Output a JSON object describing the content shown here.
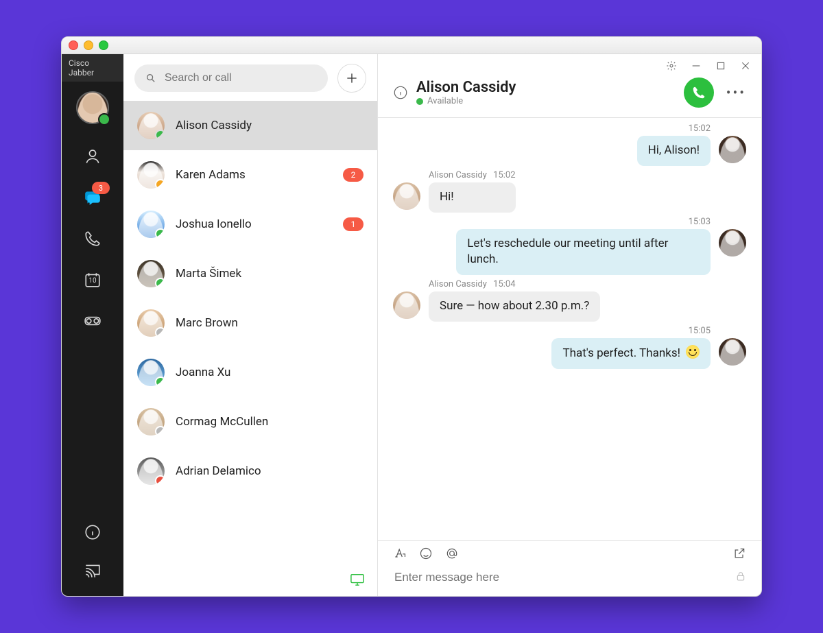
{
  "app_title": "Cisco Jabber",
  "search_placeholder": "Search or call",
  "nav": {
    "chat_badge": "3",
    "calendar_day": "10"
  },
  "contacts": [
    {
      "name": "Alison Cassidy",
      "presence": "green",
      "badge": "",
      "selected": true,
      "avatar": "av1"
    },
    {
      "name": "Karen Adams",
      "presence": "orange",
      "badge": "2",
      "selected": false,
      "avatar": "av2"
    },
    {
      "name": "Joshua Ionello",
      "presence": "green",
      "badge": "1",
      "selected": false,
      "avatar": "av3"
    },
    {
      "name": "Marta Šimek",
      "presence": "green",
      "badge": "",
      "selected": false,
      "avatar": "av4"
    },
    {
      "name": "Marc Brown",
      "presence": "grey",
      "badge": "",
      "selected": false,
      "avatar": "av5"
    },
    {
      "name": "Joanna Xu",
      "presence": "green",
      "badge": "",
      "selected": false,
      "avatar": "av6"
    },
    {
      "name": "Cormag McCullen",
      "presence": "grey",
      "badge": "",
      "selected": false,
      "avatar": "av7"
    },
    {
      "name": "Adrian Delamico",
      "presence": "red",
      "badge": "",
      "selected": false,
      "avatar": "av8"
    }
  ],
  "chat": {
    "title": "Alison Cassidy",
    "status": "Available",
    "messages": [
      {
        "dir": "out",
        "sender": "",
        "time": "15:02",
        "text": "Hi, Alison!"
      },
      {
        "dir": "in",
        "sender": "Alison Cassidy",
        "time": "15:02",
        "text": "Hi!"
      },
      {
        "dir": "out",
        "sender": "",
        "time": "15:03",
        "text": "Let's reschedule our meeting until after lunch."
      },
      {
        "dir": "in",
        "sender": "Alison Cassidy",
        "time": "15:04",
        "text": "Sure — how about 2.30 p.m.?"
      },
      {
        "dir": "out",
        "sender": "",
        "time": "15:05",
        "text": "That's perfect. Thanks!",
        "emoji": true
      }
    ],
    "composer_placeholder": "Enter message here"
  }
}
